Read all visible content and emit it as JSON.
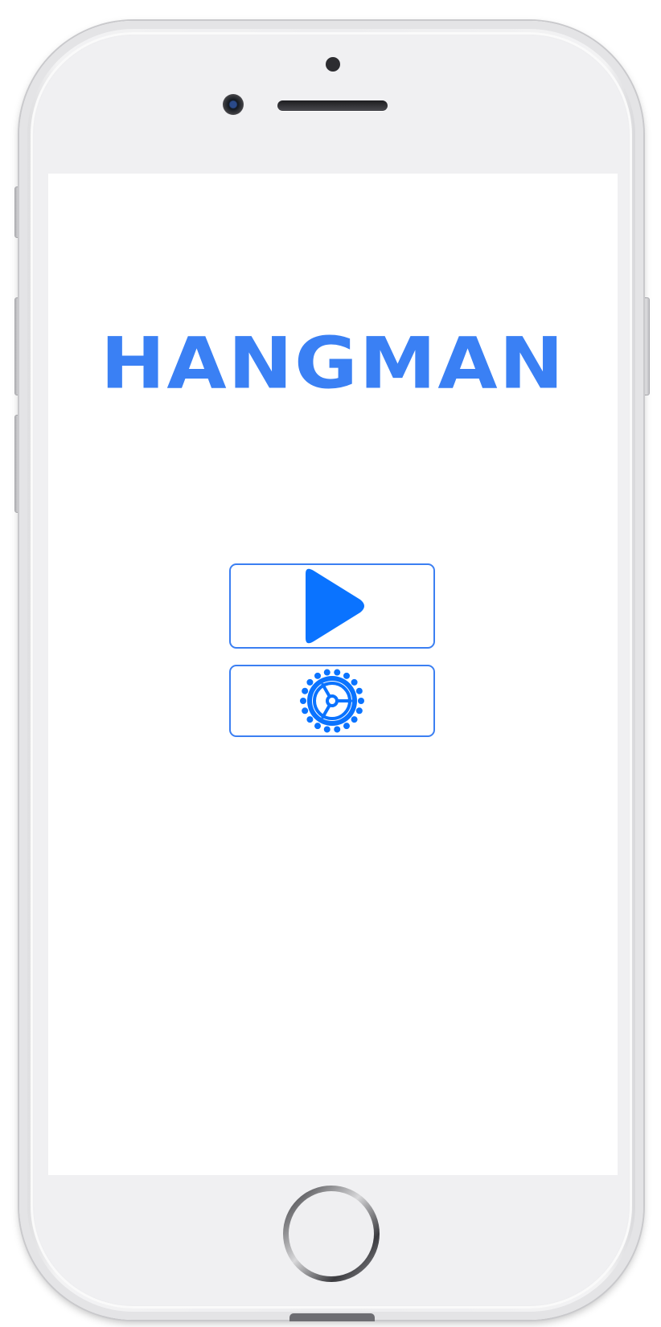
{
  "app": {
    "title": "HANGMAN"
  },
  "menu": {
    "play_icon": "play-icon",
    "settings_icon": "gear-icon"
  },
  "colors": {
    "accent": "#3a80f4",
    "button_border": "#3b7ff2",
    "icon_fill": "#0a73ff",
    "screen_bg": "#ffffff",
    "device_body": "#eeeef0"
  }
}
